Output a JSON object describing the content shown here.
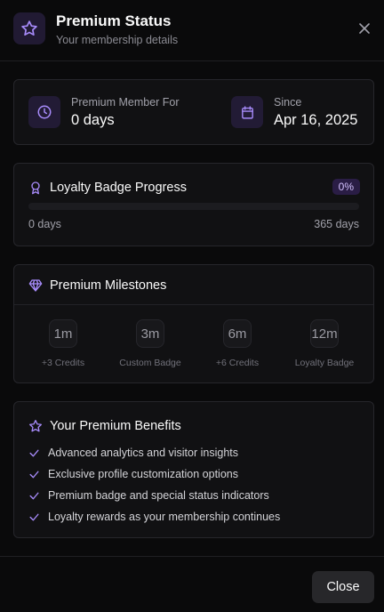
{
  "header": {
    "title": "Premium Status",
    "subtitle": "Your membership details"
  },
  "stats": {
    "member_for_label": "Premium Member For",
    "member_for_value": "0 days",
    "since_label": "Since",
    "since_value": "Apr 16, 2025"
  },
  "loyalty": {
    "title": "Loyalty Badge Progress",
    "percent_label": "0%",
    "progress_fraction": 0,
    "min_label": "0 days",
    "max_label": "365 days"
  },
  "milestones": {
    "title": "Premium Milestones",
    "items": [
      {
        "period": "1m",
        "reward": "+3 Credits"
      },
      {
        "period": "3m",
        "reward": "Custom Badge"
      },
      {
        "period": "6m",
        "reward": "+6 Credits"
      },
      {
        "period": "12m",
        "reward": "Loyalty Badge"
      }
    ]
  },
  "benefits": {
    "title": "Your Premium Benefits",
    "items": [
      "Advanced analytics and visitor insights",
      "Exclusive profile customization options",
      "Premium badge and special status indicators",
      "Loyalty rewards as your membership continues"
    ]
  },
  "footer": {
    "close_label": "Close"
  },
  "colors": {
    "accent": "#a78bfa",
    "accent_bg": "#221b35",
    "background": "#0a0a0b",
    "card": "#111113"
  },
  "icons": [
    "star-icon",
    "close-icon",
    "clock-icon",
    "calendar-icon",
    "award-icon",
    "gem-icon",
    "check-icon"
  ]
}
